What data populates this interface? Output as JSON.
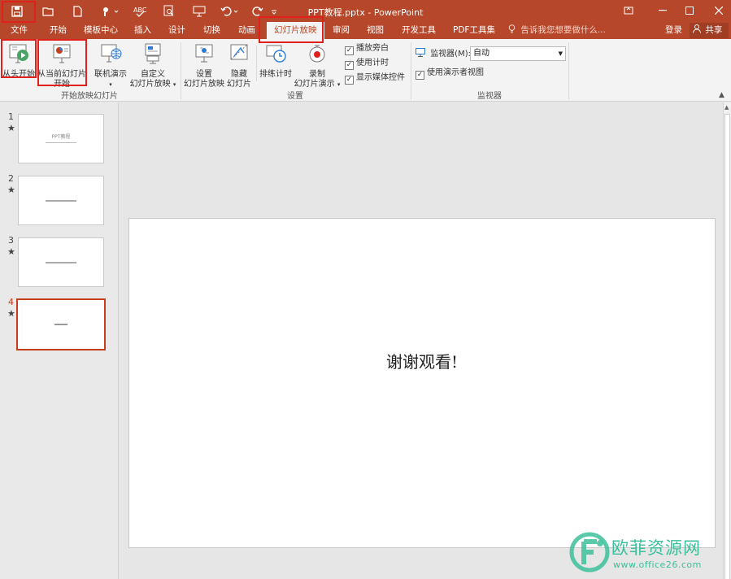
{
  "window": {
    "title": "PPT教程.pptx - PowerPoint"
  },
  "tabs": [
    {
      "label": "文件"
    },
    {
      "label": "开始"
    },
    {
      "label": "模板中心"
    },
    {
      "label": "插入"
    },
    {
      "label": "设计"
    },
    {
      "label": "切换"
    },
    {
      "label": "动画"
    },
    {
      "label": "幻灯片放映"
    },
    {
      "label": "审阅"
    },
    {
      "label": "视图"
    },
    {
      "label": "开发工具"
    },
    {
      "label": "PDF工具集"
    }
  ],
  "tell_me": "告诉我您想要做什么...",
  "account": {
    "login": "登录",
    "share": "共享"
  },
  "ribbon": {
    "start_group": {
      "label": "开始放映幻灯片",
      "from_beginning": "从头开始",
      "from_current_line1": "从当前幻灯片",
      "from_current_line2": "开始",
      "online": "联机演示",
      "custom_line1": "自定义",
      "custom_line2": "幻灯片放映"
    },
    "setup_group": {
      "label": "设置",
      "setup_line1": "设置",
      "setup_line2": "幻灯片放映",
      "hide_line1": "隐藏",
      "hide_line2": "幻灯片",
      "rehearse": "排练计时",
      "record_line1": "录制",
      "record_line2": "幻灯片演示",
      "play_narrations": "播放旁白",
      "use_timings": "使用计时",
      "show_media_controls": "显示媒体控件"
    },
    "monitors_group": {
      "label": "监视器",
      "monitor_label": "监视器(M):",
      "monitor_value": "自动",
      "presenter_view": "使用演示者视图"
    }
  },
  "slides": [
    {
      "num": "1",
      "text": "PPT教程"
    },
    {
      "num": "2",
      "text": ""
    },
    {
      "num": "3",
      "text": ""
    },
    {
      "num": "4",
      "text": ""
    }
  ],
  "current_slide": {
    "text": "谢谢观看!"
  },
  "watermark": {
    "name": "欧菲资源网",
    "url": "www.office26.com"
  },
  "colors": {
    "accent": "#b7472a",
    "highlight": "#e0201b",
    "watermark": "#3dbf9b"
  }
}
